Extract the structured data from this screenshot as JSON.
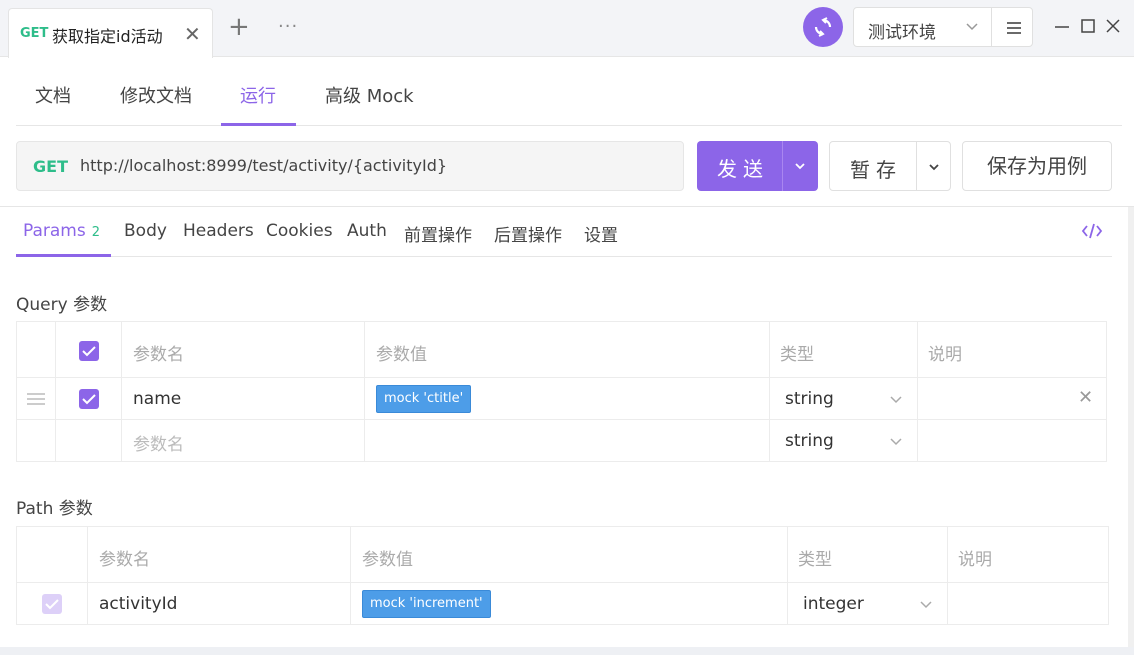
{
  "topbar": {
    "request_tab": {
      "method": "GET",
      "title": "获取指定id活动"
    },
    "env_label": "测试环境"
  },
  "subtabs": [
    "文档",
    "修改文档",
    "运行",
    "高级 Mock"
  ],
  "subtab_active": "运行",
  "urlbar": {
    "method": "GET",
    "url": "http://localhost:8999/test/activity/{activityId}",
    "send_label": "发送",
    "stash_label": "暂存",
    "save_as_label": "保存为用例"
  },
  "param_tabs": {
    "params": "Params",
    "params_count": "2",
    "body": "Body",
    "headers": "Headers",
    "cookies": "Cookies",
    "auth": "Auth",
    "pre": "前置操作",
    "post": "后置操作",
    "settings": "设置"
  },
  "query": {
    "title": "Query 参数",
    "headers": {
      "name": "参数名",
      "value": "参数值",
      "type": "类型",
      "desc": "说明"
    },
    "rows": [
      {
        "name": "name",
        "mock": "mock 'ctitle'",
        "type": "string",
        "enabled": true
      }
    ],
    "new_row": {
      "name_placeholder": "参数名",
      "type": "string"
    }
  },
  "path": {
    "title": "Path 参数",
    "headers": {
      "name": "参数名",
      "value": "参数值",
      "type": "类型",
      "desc": "说明"
    },
    "rows": [
      {
        "name": "activityId",
        "mock": "mock 'increment'",
        "type": "integer",
        "enabled": true
      }
    ]
  },
  "colors": {
    "accent": "#8c65e8",
    "get_method": "#2ebd8a",
    "mock_tag": "#4d9de8"
  },
  "icons": [
    "sync-icon",
    "chevron-down-icon",
    "menu-icon",
    "minimize-icon",
    "maximize-icon",
    "close-icon",
    "plus-icon",
    "more-icon",
    "code-icon",
    "drag-handle-icon",
    "check-icon"
  ]
}
